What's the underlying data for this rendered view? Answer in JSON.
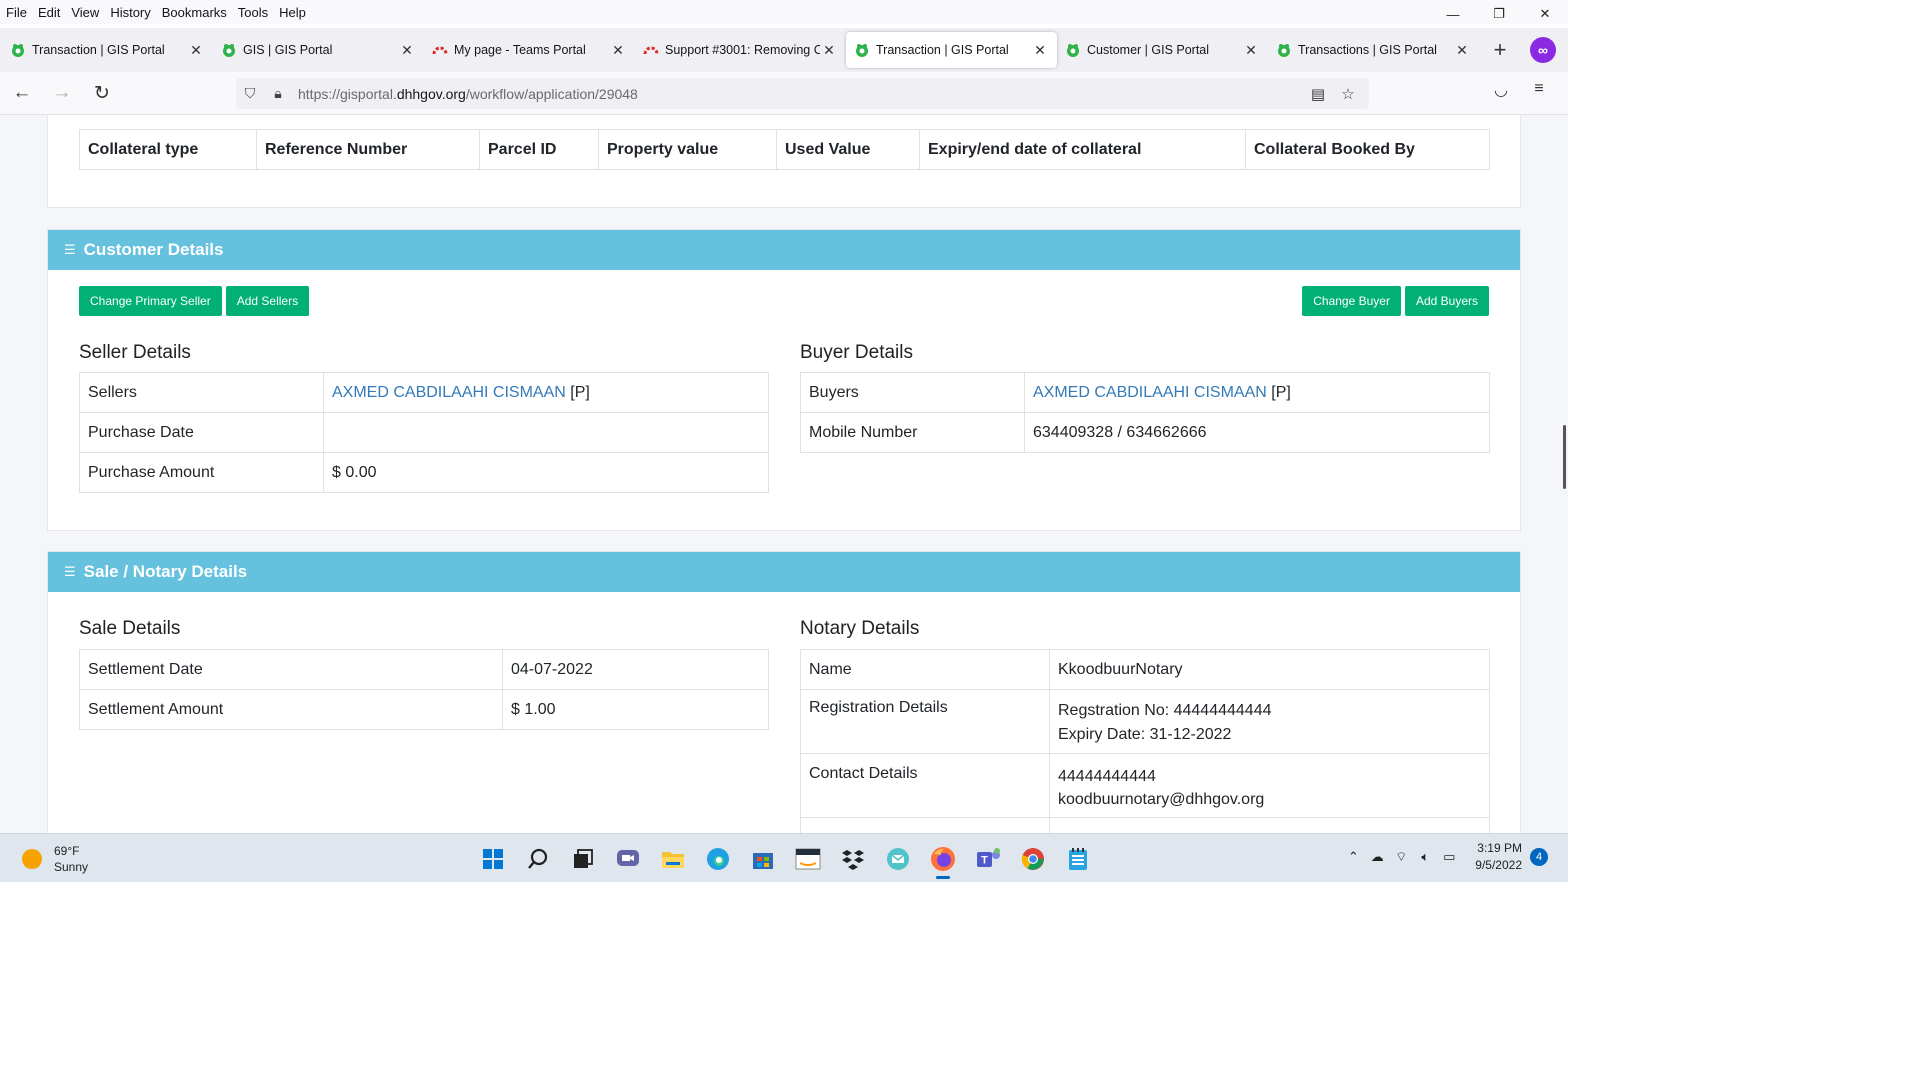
{
  "menubar": {
    "items": [
      "File",
      "Edit",
      "View",
      "History",
      "Bookmarks",
      "Tools",
      "Help"
    ]
  },
  "window_controls": {
    "minimize": "—",
    "restore": "❐",
    "close": "✕"
  },
  "tabs": [
    {
      "title": "Transaction | GIS Portal",
      "icon": "gis-favicon"
    },
    {
      "title": "GIS | GIS Portal",
      "icon": "gis-favicon"
    },
    {
      "title": "My page - Teams Portal",
      "icon": "teams-portal-favicon"
    },
    {
      "title": "Support #3001: Removing C",
      "icon": "teams-portal-favicon"
    },
    {
      "title": "Transaction | GIS Portal",
      "icon": "gis-favicon",
      "active": true
    },
    {
      "title": "Customer | GIS Portal",
      "icon": "gis-favicon"
    },
    {
      "title": "Transactions | GIS Portal",
      "icon": "gis-favicon"
    }
  ],
  "navbar": {
    "url_prefix": "https://gisportal.",
    "url_host": "dhhgov.org",
    "url_path": "/workflow/application/29048"
  },
  "collateral_table": {
    "headers": [
      "Collateral type",
      "Reference Number",
      "Parcel ID",
      "Property value",
      "Used Value",
      "Expiry/end date of collateral",
      "Collateral Booked By"
    ]
  },
  "customer_details": {
    "title": "Customer Details",
    "buttons": {
      "change_primary_seller": "Change Primary Seller",
      "add_sellers": "Add Sellers",
      "change_buyer": "Change Buyer",
      "add_buyers": "Add Buyers"
    },
    "seller": {
      "title": "Seller Details",
      "sellers_label": "Sellers",
      "sellers_name": "AXMED CABDILAAHI CISMAAN",
      "sellers_suffix": " [P]",
      "purchase_date_label": "Purchase Date",
      "purchase_date": "",
      "purchase_amount_label": "Purchase Amount",
      "purchase_amount": "$ 0.00"
    },
    "buyer": {
      "title": "Buyer Details",
      "buyers_label": "Buyers",
      "buyers_name": "AXMED CABDILAAHI CISMAAN",
      "buyers_suffix": " [P]",
      "mobile_label": "Mobile Number",
      "mobile": "634409328 / 634662666"
    }
  },
  "sale_notary": {
    "title": "Sale / Notary Details",
    "sale": {
      "title": "Sale Details",
      "settlement_date_label": "Settlement Date",
      "settlement_date": "04-07-2022",
      "settlement_amount_label": "Settlement Amount",
      "settlement_amount": "$ 1.00"
    },
    "notary": {
      "title": "Notary Details",
      "name_label": "Name",
      "name": "KkoodbuurNotary",
      "registration_label": "Registration Details",
      "registration_no": "Regstration No: 44444444444",
      "expiry_date": "Expiry Date: 31-12-2022",
      "contact_label": "Contact Details",
      "contact_phone": "44444444444",
      "contact_email": "koodbuurnotary@dhhgov.org"
    }
  },
  "taskbar": {
    "weather_temp": "69°F",
    "weather_desc": "Sunny",
    "time": "3:19 PM",
    "date": "9/5/2022",
    "notification_count": "4"
  },
  "colors": {
    "header_blue": "#65c1de",
    "button_green": "#00b074",
    "link_blue": "#337ab7"
  }
}
